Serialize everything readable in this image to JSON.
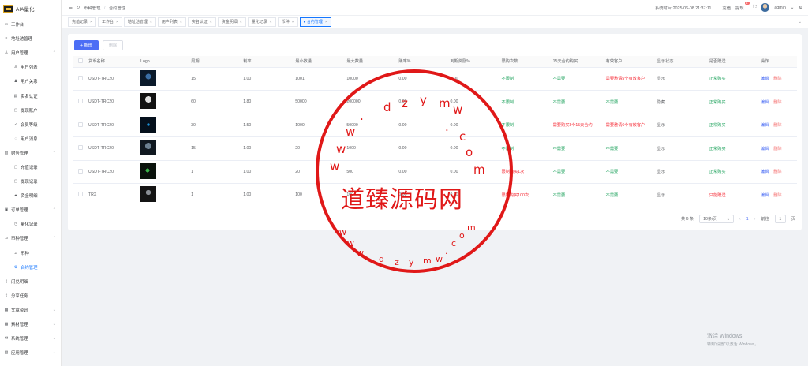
{
  "brand": {
    "name": "AIA量化"
  },
  "sidebar": {
    "items": [
      {
        "label": "工作台",
        "icon": "monitor-icon",
        "level": 0
      },
      {
        "label": "地址池管理",
        "icon": "list-icon",
        "level": 0
      },
      {
        "label": "用户管理",
        "icon": "user-icon",
        "level": 0,
        "arrow": "^"
      },
      {
        "label": "用户列表",
        "icon": "user-icon",
        "level": 1
      },
      {
        "label": "用户关系",
        "icon": "users-icon",
        "level": 1
      },
      {
        "label": "实名认证",
        "icon": "idcard-icon",
        "level": 1
      },
      {
        "label": "提现账户",
        "icon": "folder-icon",
        "level": 1
      },
      {
        "label": "会员等级",
        "icon": "rocket-icon",
        "level": 1
      },
      {
        "label": "用户消息",
        "icon": "message-icon",
        "level": 1
      },
      {
        "label": "财务管理",
        "icon": "finance-icon",
        "level": 0,
        "arrow": "^"
      },
      {
        "label": "充值记录",
        "icon": "folder-icon",
        "level": 1
      },
      {
        "label": "提现记录",
        "icon": "folder-icon",
        "level": 1
      },
      {
        "label": "资金明细",
        "icon": "wallet-icon",
        "level": 1
      },
      {
        "label": "订单管理",
        "icon": "order-icon",
        "level": 0,
        "arrow": "^"
      },
      {
        "label": "量化记录",
        "icon": "clock-icon",
        "level": 1
      },
      {
        "label": "币种管理",
        "icon": "chart-icon",
        "level": 0,
        "arrow": "^"
      },
      {
        "label": "币种",
        "icon": "chart-icon",
        "level": 1
      },
      {
        "label": "合约管理",
        "icon": "gear-icon",
        "level": 1,
        "active": true
      },
      {
        "label": "闪兑明细",
        "icon": "doc-icon",
        "level": 0
      },
      {
        "label": "分享任务",
        "icon": "share-icon",
        "level": 0
      },
      {
        "label": "文章资讯",
        "icon": "article-icon",
        "level": 0,
        "arrow": "v"
      },
      {
        "label": "素材管理",
        "icon": "image-icon",
        "level": 0,
        "arrow": "v"
      },
      {
        "label": "系统管理",
        "icon": "settings-icon",
        "level": 0,
        "arrow": "v"
      },
      {
        "label": "应用管理",
        "icon": "app-icon",
        "level": 0,
        "arrow": "v"
      }
    ]
  },
  "topbar": {
    "breadcrumb": [
      "币种管理",
      "合约管理"
    ],
    "separator": "/",
    "time_label": "系统时间:",
    "time": "2025-06-08 21:37:11",
    "recharge": "充值",
    "withdraw": "提现",
    "withdraw_badge": "1",
    "user": "admin"
  },
  "tabs": [
    {
      "label": "充值记录",
      "active": false
    },
    {
      "label": "工作台",
      "active": false
    },
    {
      "label": "地址池管理",
      "active": false
    },
    {
      "label": "用户列表",
      "active": false
    },
    {
      "label": "实名认证",
      "active": false
    },
    {
      "label": "资金明细",
      "active": false
    },
    {
      "label": "量化记录",
      "active": false
    },
    {
      "label": "币种",
      "active": false
    },
    {
      "label": "● 合约管理",
      "active": true
    }
  ],
  "toolbar": {
    "add": "+ 新增",
    "delete": "删除"
  },
  "table": {
    "headers": [
      "货币名称",
      "Logo",
      "周期",
      "利率",
      "最小数量",
      "最大数量",
      "赎率%",
      "到期奖励%",
      "限购次数",
      "15天合约购买",
      "有效客户",
      "显示状态",
      "是否赠送",
      "操作"
    ],
    "rows": [
      {
        "name": "USDT-TRC20",
        "period": "15",
        "rate": "1.00",
        "min": "1001",
        "max": "10000",
        "redeem": "0.00",
        "reward": "0.00",
        "limit": "不限制",
        "buy15": "不需要",
        "customers": "需要邀请5个有效客户",
        "status": "显示",
        "gift": "正常购买"
      },
      {
        "name": "USDT-TRC20",
        "period": "60",
        "rate": "1.80",
        "min": "50000",
        "max": "200000",
        "redeem": "0.00",
        "reward": "0.00",
        "limit": "不限制",
        "buy15": "不需要",
        "customers": "不需要",
        "status": "隐藏",
        "gift": "正常购买"
      },
      {
        "name": "USDT-TRC20",
        "period": "30",
        "rate": "1.50",
        "min": "1000",
        "max": "50000",
        "redeem": "0.00",
        "reward": "0.00",
        "limit": "不限制",
        "buy15": "需要购买3个15天合约",
        "customers": "需要邀请6个有效客户",
        "status": "显示",
        "gift": "正常购买"
      },
      {
        "name": "USDT-TRC20",
        "period": "15",
        "rate": "1.00",
        "min": "20",
        "max": "1000",
        "redeem": "0.00",
        "reward": "0.00",
        "limit": "不限制",
        "buy15": "不需要",
        "customers": "不需要",
        "status": "显示",
        "gift": "正常购买"
      },
      {
        "name": "USDT-TRC20",
        "period": "1",
        "rate": "1.00",
        "min": "20",
        "max": "500",
        "redeem": "0.00",
        "reward": "0.00",
        "limit": "限制购买1次",
        "buy15": "不需要",
        "customers": "不需要",
        "status": "显示",
        "gift": "正常购买"
      },
      {
        "name": "TRX",
        "period": "1",
        "rate": "1.00",
        "min": "100",
        "max": "100",
        "redeem": "0.00",
        "reward": "0.00",
        "limit": "限制购买100次",
        "buy15": "不需要",
        "customers": "不需要",
        "status": "显示",
        "gift": "只能赠送"
      }
    ],
    "edit": "编辑",
    "delete": "删除"
  },
  "pagination": {
    "total": "共 6 条",
    "size": "10条/页",
    "page": "1",
    "goto": "前往",
    "goto_value": "1",
    "unit": "页"
  },
  "watermark": {
    "text": "道臻源码网",
    "top": [
      "w",
      "w",
      "w",
      ".",
      "d",
      "z",
      "y",
      "m",
      "w",
      ".",
      "c",
      "o",
      "m"
    ],
    "bottom": [
      "w",
      "w",
      "w",
      ".",
      "d",
      "z",
      "y",
      "m",
      "w",
      ".",
      "c",
      "o",
      "m"
    ]
  },
  "activation": {
    "title": "激活 Windows",
    "sub": "转到\"设置\"以激活 Windows。"
  }
}
